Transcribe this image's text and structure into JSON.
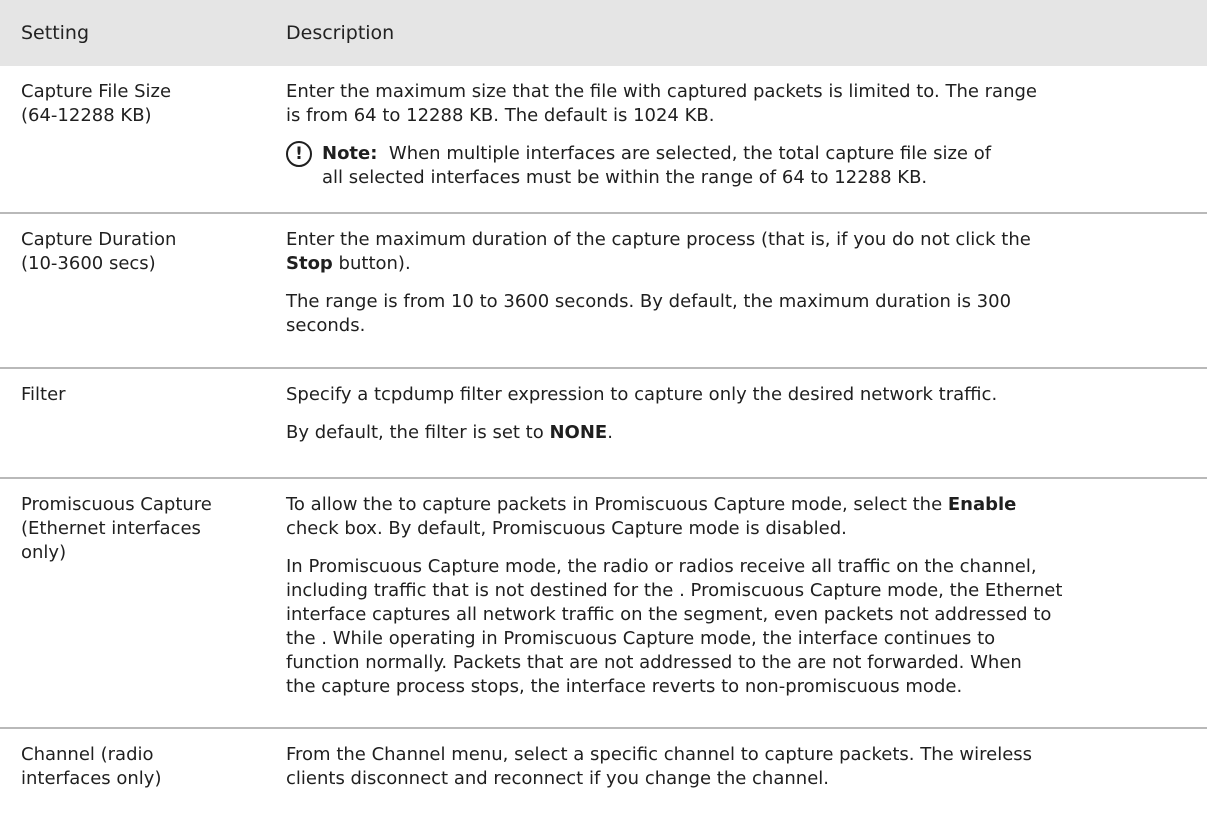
{
  "header": {
    "setting": "Setting",
    "description": "Description"
  },
  "rows": [
    {
      "setting": [
        "Capture File Size",
        "(64-12288 KB)"
      ],
      "desc": [
        "Enter the maximum size that the file with captured packets is limited to. The range",
        "is from 64 to 12288 KB. The default is 1024 KB."
      ],
      "note": {
        "label": "Note:",
        "lines": [
          "When multiple interfaces are selected, the total capture file size of",
          "all selected interfaces must be within the range of 64 to 12288 KB."
        ]
      }
    },
    {
      "setting": [
        "Capture Duration",
        "(10-3600 secs)"
      ],
      "desc1_line1": "Enter the maximum duration of the capture process (that is, if you do not click the",
      "desc1_bold": "Stop",
      "desc1_tail": " button).",
      "desc2": [
        "The range is from 10 to 3600 seconds. By default, the maximum duration is 300",
        "seconds."
      ]
    },
    {
      "setting": [
        "Filter"
      ],
      "desc1": "Specify a tcpdump filter expression to capture only the desired network traffic.",
      "desc2_pre": "By default, the filter is set to ",
      "desc2_bold": "NONE",
      "desc2_post": "."
    },
    {
      "setting": [
        "Promiscuous Capture",
        "(Ethernet interfaces",
        "only)"
      ],
      "desc1_pre": "To allow the  to capture packets in Promiscuous Capture mode, select the ",
      "desc1_bold": "Enable",
      "desc1_line2": "check box. By default, Promiscuous Capture mode is disabled.",
      "desc2": [
        "In Promiscuous Capture mode, the radio or radios receive all traffic on the channel,",
        "including traffic that is not destined for the . Promiscuous Capture mode, the Ethernet",
        "interface captures all network traffic on the segment, even packets not addressed to",
        "the . While operating in Promiscuous Capture mode, the interface continues to",
        "function normally. Packets that are not addressed to the  are not forwarded. When",
        "the capture process stops, the interface reverts to non-promiscuous mode."
      ]
    },
    {
      "setting": [
        "Channel (radio",
        "interfaces only)"
      ],
      "desc": [
        "From the Channel menu, select a specific channel to capture packets. The wireless",
        "clients disconnect and reconnect if you change the channel."
      ]
    }
  ]
}
